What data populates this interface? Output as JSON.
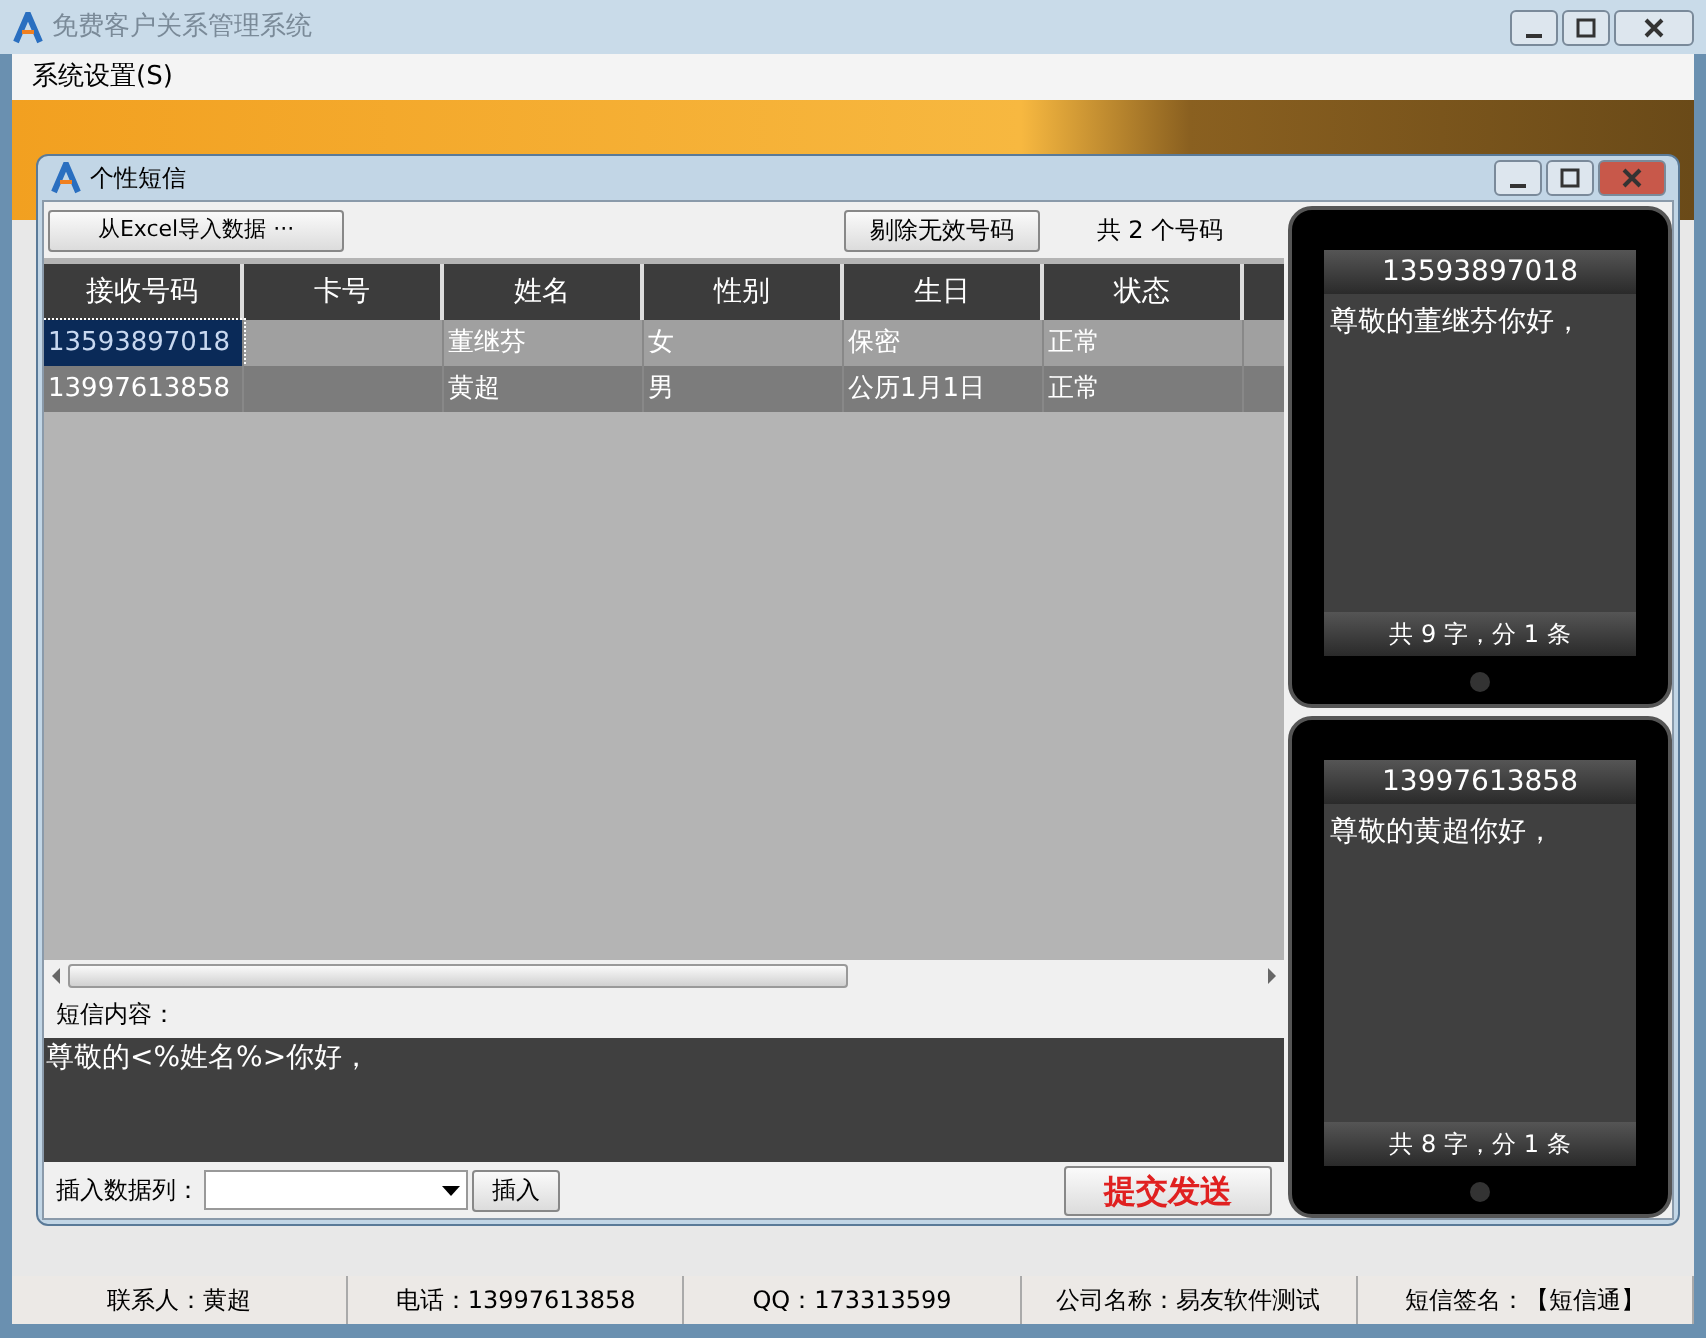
{
  "window": {
    "title": "免费客户关系管理系统"
  },
  "menu": [
    {
      "label": "系统设置(S)"
    }
  ],
  "dialog": {
    "title": "个性短信",
    "toolbar": {
      "import_button": "从Excel导入数据  ···",
      "remove_button": "剔除无效号码",
      "count": "共 2 个号码"
    },
    "table": {
      "columns": [
        "接收号码",
        "卡号",
        "姓名",
        "性别",
        "生日",
        "状态"
      ],
      "rows": [
        {
          "selected": true,
          "cells": [
            "13593897018",
            "",
            "董继芬",
            "女",
            "保密",
            "正常"
          ]
        },
        {
          "selected": false,
          "cells": [
            "13997613858",
            "",
            "黄超",
            "男",
            "公历1月1日",
            "正常"
          ]
        }
      ]
    },
    "content_label": "短信内容：",
    "content": "尊敬的<%姓名%>你好，",
    "insert_label": "插入数据列：",
    "insert_button": "插入",
    "submit_button": "提交发送",
    "previews": [
      {
        "number": "13593897018",
        "message": "尊敬的董继芬你好，",
        "summary": "共 9 字，分 1 条"
      },
      {
        "number": "13997613858",
        "message": "尊敬的黄超你好，",
        "summary": "共 8 字，分 1 条"
      }
    ]
  },
  "status_bar": [
    "联系人：黄超",
    "电话：13997613858",
    "QQ：173313599",
    "公司名称：易友软件测试",
    "短信签名：【短信通】"
  ]
}
